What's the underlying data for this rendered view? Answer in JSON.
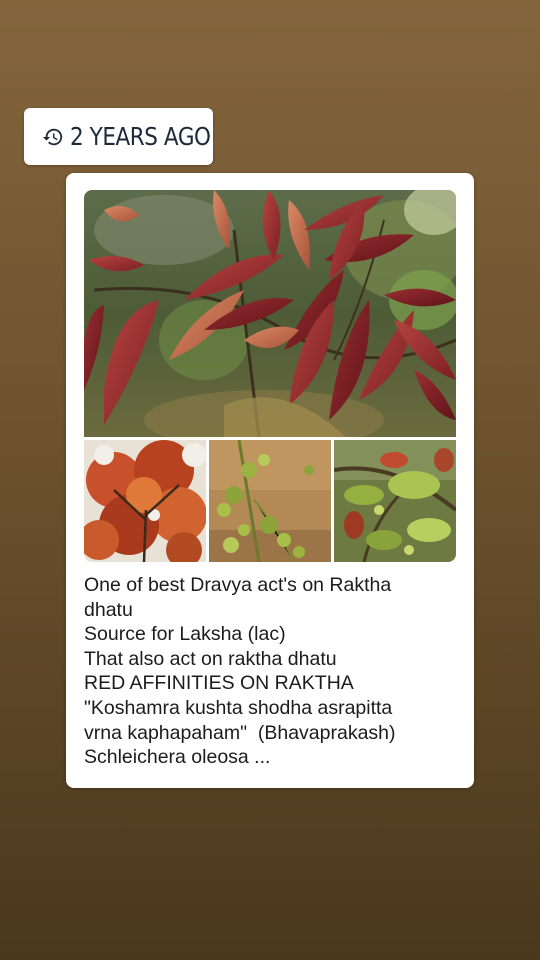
{
  "time_badge": {
    "icon": "history-icon",
    "text": "2 YEARS AGO"
  },
  "post": {
    "images": [
      {
        "name": "red-leaves-photo",
        "subject": "red young leaves"
      },
      {
        "name": "tree-canopy-photo",
        "subject": "orange canopy"
      },
      {
        "name": "flower-spikes-photo",
        "subject": "green flower spikes"
      },
      {
        "name": "fruit-branch-photo",
        "subject": "fruit branches"
      }
    ],
    "caption_lines": [
      "One of best Dravya act's on Raktha",
      "dhatu",
      "Source for Laksha (lac)",
      "That also act on raktha dhatu",
      "RED AFFINITIES ON RAKTHA",
      "\"Koshamra kushta shodha asrapitta",
      "vrna kaphapaham\"  (Bhavaprakash)",
      "Schleichera oleosa ..."
    ]
  },
  "colors": {
    "background_top": "#84653c",
    "background_bottom": "#4a381d",
    "badge_text": "#1d2a3a",
    "card": "#ffffff",
    "caption_text": "#1c1c1c"
  }
}
